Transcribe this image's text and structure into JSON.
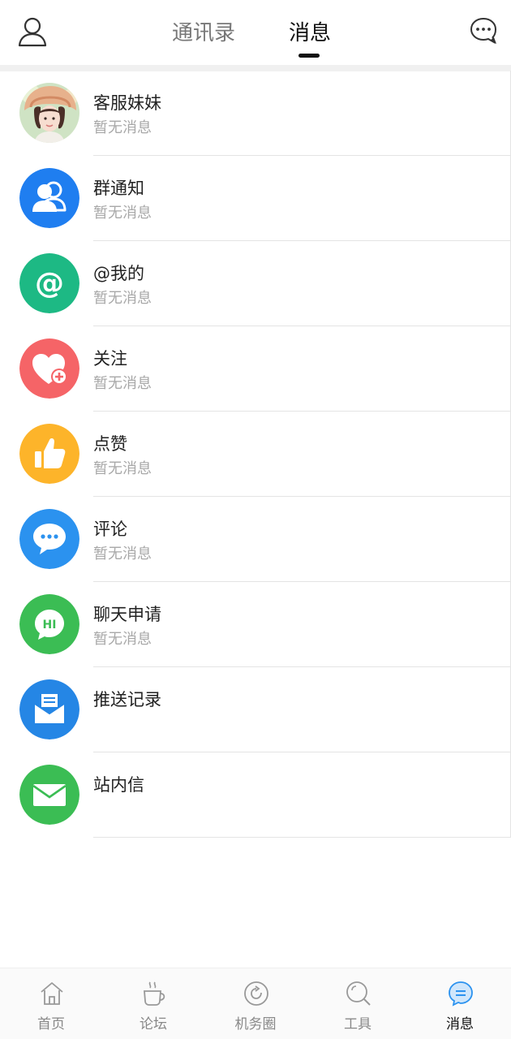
{
  "header": {
    "tabs": [
      {
        "label": "通讯录",
        "active": false
      },
      {
        "label": "消息",
        "active": true
      }
    ]
  },
  "messages": [
    {
      "title": "客服妹妹",
      "subtitle": "暂无消息",
      "icon": "customer-service-avatar",
      "color": "#e8d5c0"
    },
    {
      "title": "群通知",
      "subtitle": "暂无消息",
      "icon": "group-icon",
      "color": "#1f7ef0"
    },
    {
      "title": "@我的",
      "subtitle": "暂无消息",
      "icon": "at-icon",
      "color": "#1db984"
    },
    {
      "title": "关注",
      "subtitle": "暂无消息",
      "icon": "heart-plus-icon",
      "color": "#f56467"
    },
    {
      "title": "点赞",
      "subtitle": "暂无消息",
      "icon": "thumbs-up-icon",
      "color": "#fdb42a"
    },
    {
      "title": "评论",
      "subtitle": "暂无消息",
      "icon": "comment-icon",
      "color": "#2b92ef"
    },
    {
      "title": "聊天申请",
      "subtitle": "暂无消息",
      "icon": "chat-request-icon",
      "color": "#3bbd54"
    },
    {
      "title": "推送记录",
      "subtitle": "",
      "icon": "push-record-icon",
      "color": "#2586e5"
    },
    {
      "title": "站内信",
      "subtitle": "",
      "icon": "mail-icon",
      "color": "#3bbd54"
    }
  ],
  "bottom_nav": [
    {
      "label": "首页",
      "icon": "home-icon",
      "active": false
    },
    {
      "label": "论坛",
      "icon": "coffee-icon",
      "active": false
    },
    {
      "label": "机务圈",
      "icon": "refresh-circle-icon",
      "active": false
    },
    {
      "label": "工具",
      "icon": "search-icon",
      "active": false
    },
    {
      "label": "消息",
      "icon": "message-icon",
      "active": true
    }
  ],
  "colors": {
    "accent": "#2b92ef",
    "text_primary": "#222222",
    "text_secondary": "#a8a8a8"
  }
}
